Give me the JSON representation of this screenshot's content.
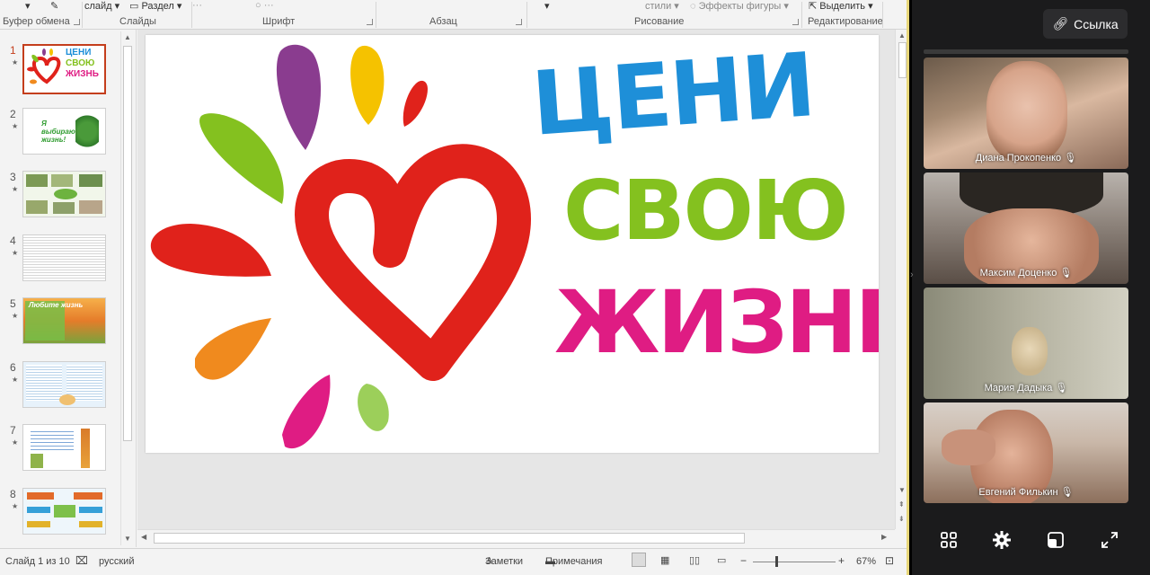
{
  "ribbon": {
    "top_items": [
      "слайд",
      "Раздел",
      "стили",
      "Эффекты фигуры",
      "Выделить"
    ],
    "groups": [
      "Буфер обмена",
      "Слайды",
      "Шрифт",
      "Абзац",
      "Рисование",
      "Редактирование"
    ]
  },
  "thumbnails": [
    {
      "number": "1",
      "star": "★",
      "title_lines": [
        "ЦЕНИ",
        "СВОЮ",
        "ЖИЗНЬ"
      ]
    },
    {
      "number": "2",
      "star": "★",
      "text": "Я выбираю жизнь!"
    },
    {
      "number": "3",
      "star": "★"
    },
    {
      "number": "4",
      "star": "★"
    },
    {
      "number": "5",
      "star": "★",
      "text": "Любите жизнь"
    },
    {
      "number": "6",
      "star": "★"
    },
    {
      "number": "7",
      "star": "★"
    },
    {
      "number": "8",
      "star": "★"
    }
  ],
  "slide": {
    "line1": "ЦЕНИ",
    "line2": "СВОЮ",
    "line3": "ЖИЗНЬ",
    "colors": {
      "line1": "#1e8fd8",
      "line2": "#84c11f",
      "line3": "#df1c83",
      "heart": "#e0221b"
    }
  },
  "status": {
    "slide_counter": "Слайд 1 из 10",
    "language": "русский",
    "notes": "Заметки",
    "comments": "Примечания",
    "zoom": "67%"
  },
  "conference": {
    "link_label": "Ссылка",
    "participants": [
      {
        "name": "Диана Прокопенко",
        "muted": true
      },
      {
        "name": "Максим Доценко",
        "muted": true
      },
      {
        "name": "Мария Дадыка",
        "muted": true
      },
      {
        "name": "Евгений Филькин",
        "muted": true
      }
    ],
    "toolbar": [
      "grid-icon",
      "gear-icon",
      "layout-icon",
      "fullscreen-icon"
    ]
  }
}
